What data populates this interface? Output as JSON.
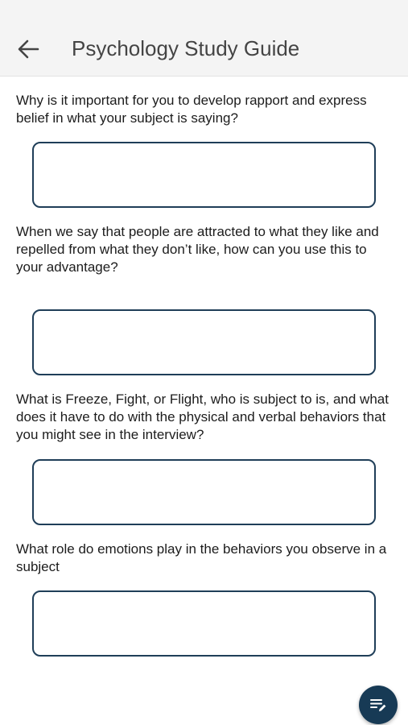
{
  "header": {
    "title": "Psychology Study Guide",
    "back_icon": "arrow-left-icon"
  },
  "questions": [
    {
      "text": "Why is it important for you to develop rapport and express belief in what your subject is saying?",
      "answer": ""
    },
    {
      "text": "When we say that people are attracted to what they like and repelled from what they don’t like, how can you use this to your advantage?",
      "answer": ""
    },
    {
      "text": "What is Freeze, Fight, or Flight, who is subject to is, and what does it have to do with the physical and verbal behaviors that you might see in the interview?",
      "answer": ""
    },
    {
      "text": "What role do emotions play in the behaviors you observe in a subject",
      "answer": ""
    }
  ],
  "fab": {
    "icon": "edit-notes-icon"
  },
  "colors": {
    "app_bar": "#f4f4f4",
    "accent": "#1f3e58",
    "fab": "#173a55",
    "text": "#1c1c1c"
  }
}
